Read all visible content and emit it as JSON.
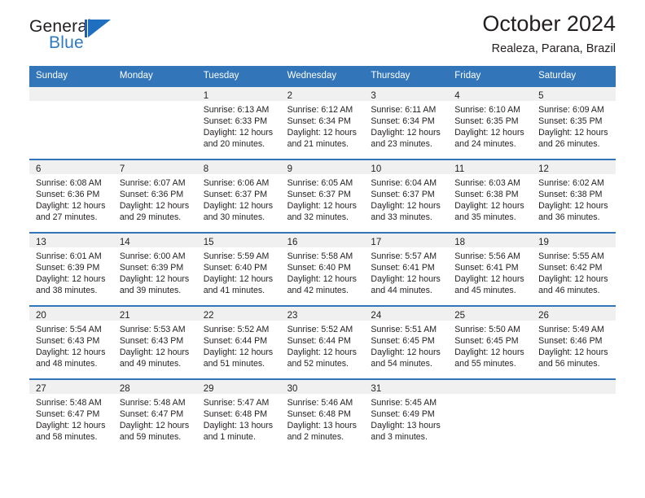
{
  "brand": {
    "name_top": "General",
    "name_bottom": "Blue",
    "mark": "triangle-flag-logo",
    "color": "#2f7bc0"
  },
  "header": {
    "title": "October 2024",
    "location": "Realeza, Parana, Brazil",
    "accent_color": "#3275b8",
    "band_color": "#f0f0f0"
  },
  "weekdays": [
    "Sunday",
    "Monday",
    "Tuesday",
    "Wednesday",
    "Thursday",
    "Friday",
    "Saturday"
  ],
  "weeks": [
    [
      {
        "day": "",
        "empty": true
      },
      {
        "day": "",
        "empty": true
      },
      {
        "day": "1",
        "sunrise": "Sunrise: 6:13 AM",
        "sunset": "Sunset: 6:33 PM",
        "daylight": "Daylight: 12 hours and 20 minutes."
      },
      {
        "day": "2",
        "sunrise": "Sunrise: 6:12 AM",
        "sunset": "Sunset: 6:34 PM",
        "daylight": "Daylight: 12 hours and 21 minutes."
      },
      {
        "day": "3",
        "sunrise": "Sunrise: 6:11 AM",
        "sunset": "Sunset: 6:34 PM",
        "daylight": "Daylight: 12 hours and 23 minutes."
      },
      {
        "day": "4",
        "sunrise": "Sunrise: 6:10 AM",
        "sunset": "Sunset: 6:35 PM",
        "daylight": "Daylight: 12 hours and 24 minutes."
      },
      {
        "day": "5",
        "sunrise": "Sunrise: 6:09 AM",
        "sunset": "Sunset: 6:35 PM",
        "daylight": "Daylight: 12 hours and 26 minutes."
      }
    ],
    [
      {
        "day": "6",
        "sunrise": "Sunrise: 6:08 AM",
        "sunset": "Sunset: 6:36 PM",
        "daylight": "Daylight: 12 hours and 27 minutes."
      },
      {
        "day": "7",
        "sunrise": "Sunrise: 6:07 AM",
        "sunset": "Sunset: 6:36 PM",
        "daylight": "Daylight: 12 hours and 29 minutes."
      },
      {
        "day": "8",
        "sunrise": "Sunrise: 6:06 AM",
        "sunset": "Sunset: 6:37 PM",
        "daylight": "Daylight: 12 hours and 30 minutes."
      },
      {
        "day": "9",
        "sunrise": "Sunrise: 6:05 AM",
        "sunset": "Sunset: 6:37 PM",
        "daylight": "Daylight: 12 hours and 32 minutes."
      },
      {
        "day": "10",
        "sunrise": "Sunrise: 6:04 AM",
        "sunset": "Sunset: 6:37 PM",
        "daylight": "Daylight: 12 hours and 33 minutes."
      },
      {
        "day": "11",
        "sunrise": "Sunrise: 6:03 AM",
        "sunset": "Sunset: 6:38 PM",
        "daylight": "Daylight: 12 hours and 35 minutes."
      },
      {
        "day": "12",
        "sunrise": "Sunrise: 6:02 AM",
        "sunset": "Sunset: 6:38 PM",
        "daylight": "Daylight: 12 hours and 36 minutes."
      }
    ],
    [
      {
        "day": "13",
        "sunrise": "Sunrise: 6:01 AM",
        "sunset": "Sunset: 6:39 PM",
        "daylight": "Daylight: 12 hours and 38 minutes."
      },
      {
        "day": "14",
        "sunrise": "Sunrise: 6:00 AM",
        "sunset": "Sunset: 6:39 PM",
        "daylight": "Daylight: 12 hours and 39 minutes."
      },
      {
        "day": "15",
        "sunrise": "Sunrise: 5:59 AM",
        "sunset": "Sunset: 6:40 PM",
        "daylight": "Daylight: 12 hours and 41 minutes."
      },
      {
        "day": "16",
        "sunrise": "Sunrise: 5:58 AM",
        "sunset": "Sunset: 6:40 PM",
        "daylight": "Daylight: 12 hours and 42 minutes."
      },
      {
        "day": "17",
        "sunrise": "Sunrise: 5:57 AM",
        "sunset": "Sunset: 6:41 PM",
        "daylight": "Daylight: 12 hours and 44 minutes."
      },
      {
        "day": "18",
        "sunrise": "Sunrise: 5:56 AM",
        "sunset": "Sunset: 6:41 PM",
        "daylight": "Daylight: 12 hours and 45 minutes."
      },
      {
        "day": "19",
        "sunrise": "Sunrise: 5:55 AM",
        "sunset": "Sunset: 6:42 PM",
        "daylight": "Daylight: 12 hours and 46 minutes."
      }
    ],
    [
      {
        "day": "20",
        "sunrise": "Sunrise: 5:54 AM",
        "sunset": "Sunset: 6:43 PM",
        "daylight": "Daylight: 12 hours and 48 minutes."
      },
      {
        "day": "21",
        "sunrise": "Sunrise: 5:53 AM",
        "sunset": "Sunset: 6:43 PM",
        "daylight": "Daylight: 12 hours and 49 minutes."
      },
      {
        "day": "22",
        "sunrise": "Sunrise: 5:52 AM",
        "sunset": "Sunset: 6:44 PM",
        "daylight": "Daylight: 12 hours and 51 minutes."
      },
      {
        "day": "23",
        "sunrise": "Sunrise: 5:52 AM",
        "sunset": "Sunset: 6:44 PM",
        "daylight": "Daylight: 12 hours and 52 minutes."
      },
      {
        "day": "24",
        "sunrise": "Sunrise: 5:51 AM",
        "sunset": "Sunset: 6:45 PM",
        "daylight": "Daylight: 12 hours and 54 minutes."
      },
      {
        "day": "25",
        "sunrise": "Sunrise: 5:50 AM",
        "sunset": "Sunset: 6:45 PM",
        "daylight": "Daylight: 12 hours and 55 minutes."
      },
      {
        "day": "26",
        "sunrise": "Sunrise: 5:49 AM",
        "sunset": "Sunset: 6:46 PM",
        "daylight": "Daylight: 12 hours and 56 minutes."
      }
    ],
    [
      {
        "day": "27",
        "sunrise": "Sunrise: 5:48 AM",
        "sunset": "Sunset: 6:47 PM",
        "daylight": "Daylight: 12 hours and 58 minutes."
      },
      {
        "day": "28",
        "sunrise": "Sunrise: 5:48 AM",
        "sunset": "Sunset: 6:47 PM",
        "daylight": "Daylight: 12 hours and 59 minutes."
      },
      {
        "day": "29",
        "sunrise": "Sunrise: 5:47 AM",
        "sunset": "Sunset: 6:48 PM",
        "daylight": "Daylight: 13 hours and 1 minute."
      },
      {
        "day": "30",
        "sunrise": "Sunrise: 5:46 AM",
        "sunset": "Sunset: 6:48 PM",
        "daylight": "Daylight: 13 hours and 2 minutes."
      },
      {
        "day": "31",
        "sunrise": "Sunrise: 5:45 AM",
        "sunset": "Sunset: 6:49 PM",
        "daylight": "Daylight: 13 hours and 3 minutes."
      },
      {
        "day": "",
        "empty": true
      },
      {
        "day": "",
        "empty": true
      }
    ]
  ]
}
